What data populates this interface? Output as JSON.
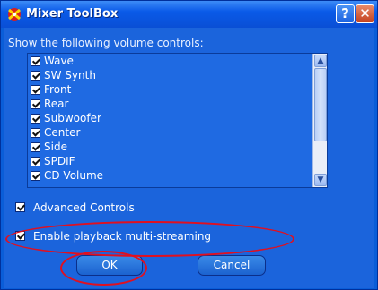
{
  "window": {
    "title": "Mixer ToolBox",
    "help_label": "?",
    "close_label": "✕"
  },
  "prompt": "Show the following volume controls:",
  "volume_controls": [
    {
      "label": "Wave",
      "checked": true
    },
    {
      "label": "SW Synth",
      "checked": true
    },
    {
      "label": "Front",
      "checked": true
    },
    {
      "label": "Rear",
      "checked": true
    },
    {
      "label": "Subwoofer",
      "checked": true
    },
    {
      "label": "Center",
      "checked": true
    },
    {
      "label": "Side",
      "checked": true
    },
    {
      "label": "SPDIF",
      "checked": true
    },
    {
      "label": "CD Volume",
      "checked": true
    }
  ],
  "options": {
    "advanced_controls": {
      "label": "Advanced Controls",
      "checked": true
    },
    "multi_streaming": {
      "label": "Enable playback multi-streaming",
      "checked": true
    }
  },
  "buttons": {
    "ok": "OK",
    "cancel": "Cancel"
  },
  "colors": {
    "annotation": "#e01020"
  }
}
